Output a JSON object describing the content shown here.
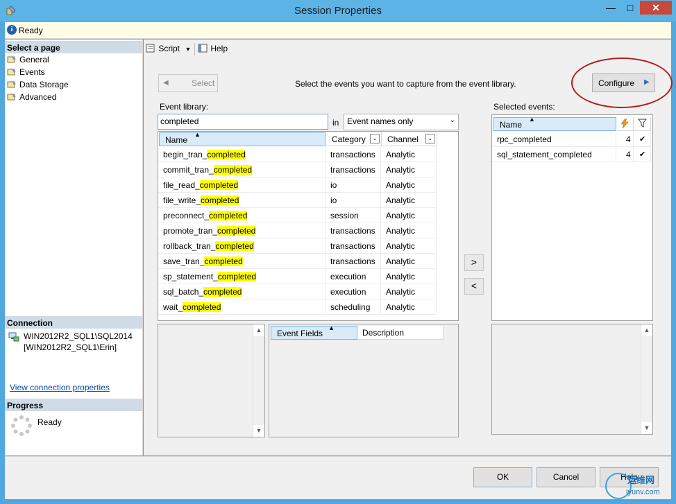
{
  "window": {
    "title": "Session Properties",
    "min_glyph": "—",
    "max_glyph": "□",
    "close_glyph": "✕"
  },
  "status": {
    "icon": "info-icon",
    "icon_glyph": "i",
    "text": "Ready"
  },
  "left": {
    "select_page_header": "Select a page",
    "pages": [
      "General",
      "Events",
      "Data Storage",
      "Advanced"
    ],
    "connection_header": "Connection",
    "connection_server": "WIN2012R2_SQL1\\SQL2014",
    "connection_user": "[WIN2012R2_SQL1\\Erin]",
    "view_connection_link": "View connection properties",
    "progress_header": "Progress",
    "progress_text": "Ready"
  },
  "toolbar": {
    "script_label": "Script",
    "script_dropdown": "▾",
    "help_label": "Help"
  },
  "events": {
    "select_button": "Select",
    "select_arrow": "◀",
    "instruction": "Select the events you want to capture from the event library.",
    "configure_button": "Configure",
    "configure_arrow": "▶",
    "library_label": "Event library:",
    "search_value": "completed",
    "in_label": "in",
    "search_scope": "Event names only",
    "combo_arrow": "⌄",
    "sort_glyph": "▲",
    "filter_glyph": "⌄",
    "columns": {
      "name": "Name",
      "category": "Category",
      "channel": "Channel"
    },
    "rows": [
      {
        "prefix": "begin_tran_",
        "match": "completed",
        "category": "transactions",
        "channel": "Analytic"
      },
      {
        "prefix": "commit_tran_",
        "match": "completed",
        "category": "transactions",
        "channel": "Analytic"
      },
      {
        "prefix": "file_read_",
        "match": "completed",
        "category": "io",
        "channel": "Analytic"
      },
      {
        "prefix": "file_write_",
        "match": "completed",
        "category": "io",
        "channel": "Analytic"
      },
      {
        "prefix": "preconnect_",
        "match": "completed",
        "category": "session",
        "channel": "Analytic"
      },
      {
        "prefix": "promote_tran_",
        "match": "completed",
        "category": "transactions",
        "channel": "Analytic"
      },
      {
        "prefix": "rollback_tran_",
        "match": "completed",
        "category": "transactions",
        "channel": "Analytic"
      },
      {
        "prefix": "save_tran_",
        "match": "completed",
        "category": "transactions",
        "channel": "Analytic"
      },
      {
        "prefix": "sp_statement_",
        "match": "completed",
        "category": "execution",
        "channel": "Analytic"
      },
      {
        "prefix": "sql_batch_",
        "match": "completed",
        "category": "execution",
        "channel": "Analytic"
      },
      {
        "prefix": "wait_",
        "match": "completed",
        "category": "scheduling",
        "channel": "Analytic"
      }
    ],
    "add_arrow": ">",
    "remove_arrow": "<",
    "selected_label": "Selected events:",
    "selected_columns": {
      "name": "Name",
      "actions_icon": "lightning-icon",
      "filter_icon": "funnel-icon"
    },
    "selected_rows": [
      {
        "name": "rpc_completed",
        "count": "4",
        "filter": "✔"
      },
      {
        "name": "sql_statement_completed",
        "count": "4",
        "filter": "✔"
      }
    ],
    "fields_columns": {
      "event_fields": "Event Fields",
      "description": "Description"
    },
    "scroll_up": "▲",
    "scroll_down": "▼"
  },
  "footer": {
    "ok": "OK",
    "cancel": "Cancel",
    "help": "Help"
  },
  "watermark": {
    "cn_text": "运维网",
    "url": "iyunv.com"
  },
  "colors": {
    "title_bar": "#5cb3e6",
    "highlight": "#ffff00",
    "callout": "#b01d1d",
    "close_button": "#c7493b"
  }
}
